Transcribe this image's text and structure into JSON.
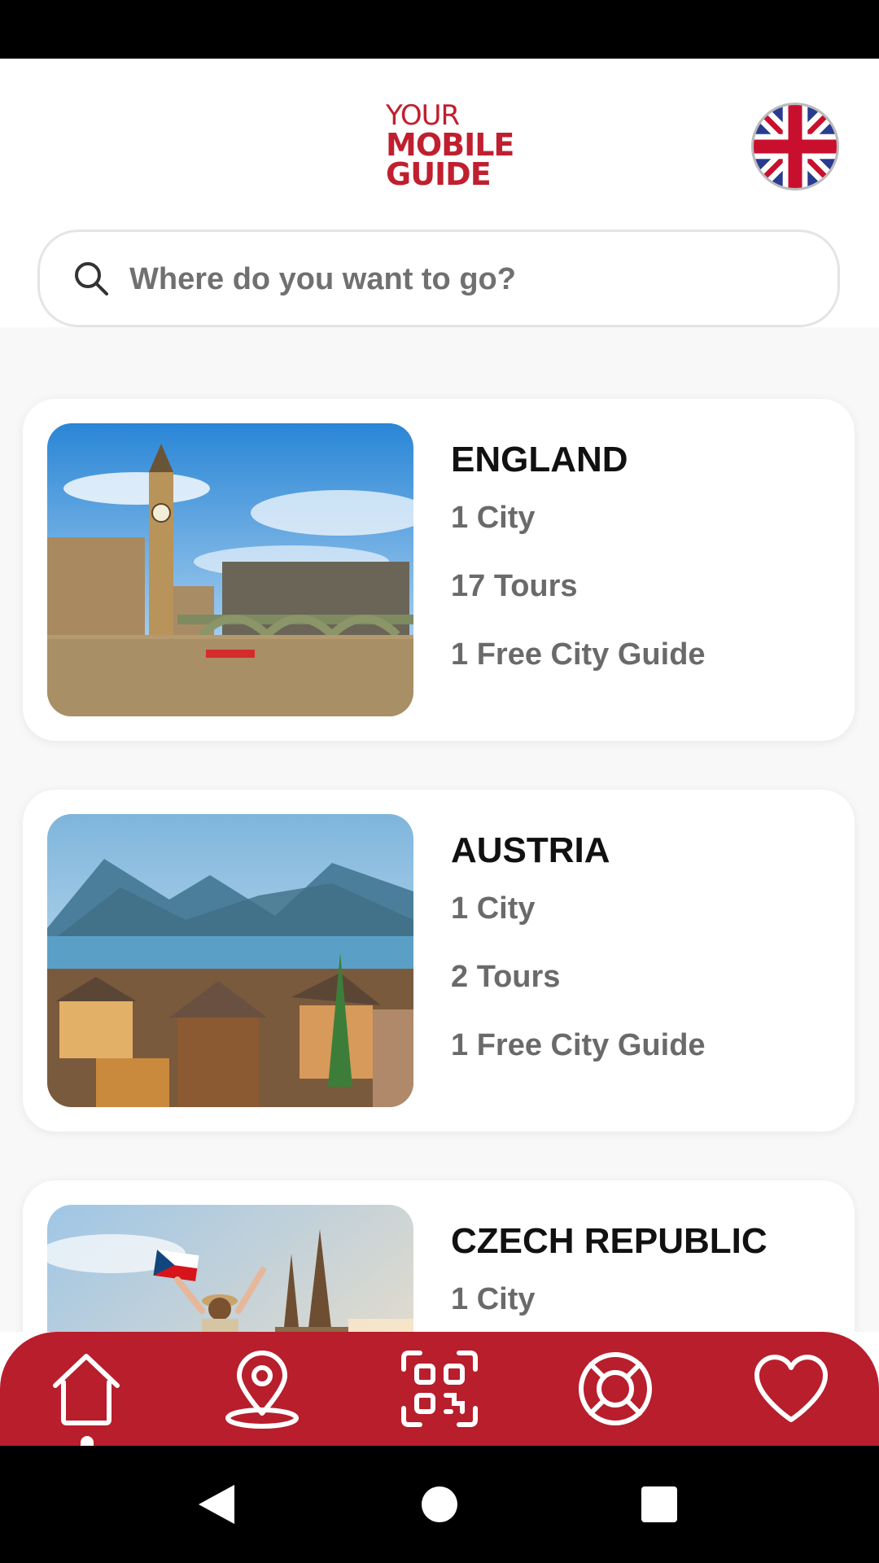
{
  "header": {
    "logo": {
      "line1": "YOUR",
      "line2": "MOBILE",
      "line3": "GUIDE"
    },
    "language_flag_icon": "uk-flag-icon"
  },
  "search": {
    "placeholder": "Where do you want to go?",
    "value": "",
    "icon": "search-icon"
  },
  "destinations": [
    {
      "name": "ENGLAND",
      "cities": "1 City",
      "tours": "17 Tours",
      "guides": "1 Free City Guide",
      "image": "london-big-ben-photo"
    },
    {
      "name": "AUSTRIA",
      "cities": "1 City",
      "tours": "2 Tours",
      "guides": "1 Free City Guide",
      "image": "hallstatt-lake-photo"
    },
    {
      "name": "CZECH REPUBLIC",
      "cities": "1 City",
      "image": "prague-traveler-photo"
    }
  ],
  "tabbar": {
    "active": "home",
    "items": [
      {
        "name": "home",
        "icon": "home-icon"
      },
      {
        "name": "map",
        "icon": "map-pin-icon"
      },
      {
        "name": "qr",
        "icon": "qr-code-icon"
      },
      {
        "name": "help",
        "icon": "lifebuoy-icon"
      },
      {
        "name": "favorites",
        "icon": "heart-icon"
      }
    ]
  },
  "colors": {
    "brand_red": "#b81e2c",
    "logo_red": "#c01f2f",
    "text_dark": "#111111",
    "text_grey": "#6a6a6a"
  }
}
